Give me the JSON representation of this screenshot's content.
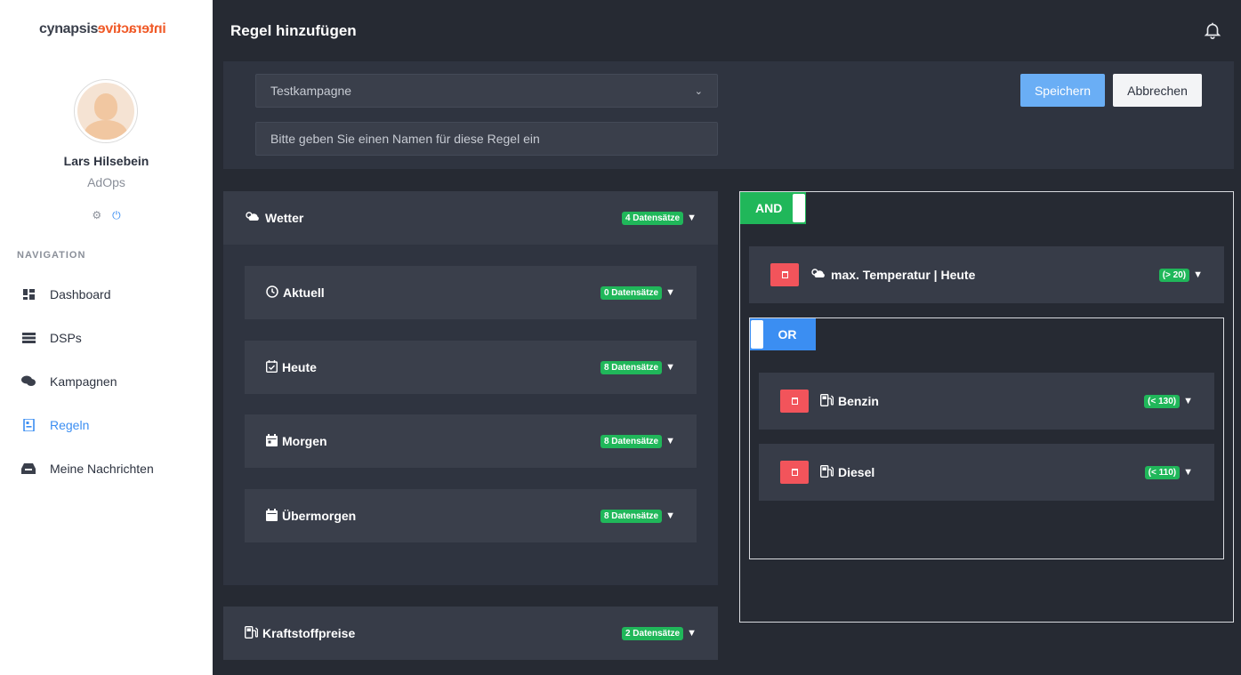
{
  "sidebar": {
    "logo_left": "cynapsis",
    "logo_right": "interactive",
    "user_name": "Lars Hilsebein",
    "user_role": "AdOps",
    "nav_title": "NAVIGATION",
    "items": [
      {
        "label": "Dashboard",
        "icon": "dashboard-icon",
        "active": false
      },
      {
        "label": "DSPs",
        "icon": "server-icon",
        "active": false
      },
      {
        "label": "Kampagnen",
        "icon": "comments-icon",
        "active": false
      },
      {
        "label": "Regeln",
        "icon": "rules-icon",
        "active": true
      },
      {
        "label": "Meine Nachrichten",
        "icon": "inbox-icon",
        "active": false
      }
    ],
    "accent": "#3b8ef2"
  },
  "header": {
    "title": "Regel hinzufügen"
  },
  "form": {
    "campaign_selected": "Testkampagne",
    "name_placeholder": "Bitte geben Sie einen Namen für diese Regel ein",
    "save_label": "Speichern",
    "cancel_label": "Abbrechen"
  },
  "data_sources": {
    "weather": {
      "label": "Wetter",
      "badge": "4 Datensätze",
      "children": [
        {
          "label": "Aktuell",
          "badge": "0 Datensätze",
          "icon": "clock-icon"
        },
        {
          "label": "Heute",
          "badge": "8 Datensätze",
          "icon": "calendar-check-icon"
        },
        {
          "label": "Morgen",
          "badge": "8 Datensätze",
          "icon": "calendar-icon"
        },
        {
          "label": "Übermorgen",
          "badge": "8 Datensätze",
          "icon": "calendar-icon"
        }
      ]
    },
    "fuel": {
      "label": "Kraftstoffpreise",
      "badge": "2 Datensätze"
    }
  },
  "logic": {
    "and_label": "AND",
    "and_color": "#20b75a",
    "or_label": "OR",
    "or_color": "#3b8ef2",
    "and_rule": {
      "label": "max. Temperatur | Heute",
      "condition": "(> 20)"
    },
    "or_rules": [
      {
        "label": "Benzin",
        "condition": "(< 130)"
      },
      {
        "label": "Diesel",
        "condition": "(< 110)"
      }
    ]
  }
}
